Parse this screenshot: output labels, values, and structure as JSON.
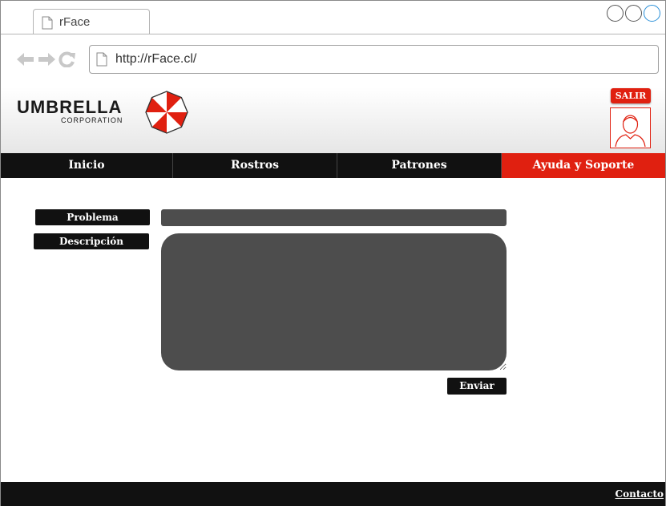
{
  "browser": {
    "tab_title": "rFace",
    "url": "http://rFace.cl/"
  },
  "header": {
    "logo_main": "UMBRELLA",
    "logo_sub": "CORPORATION",
    "logout_label": "SALIR"
  },
  "nav": {
    "items": [
      {
        "label": "Inicio"
      },
      {
        "label": "Rostros"
      },
      {
        "label": "Patrones"
      },
      {
        "label": "Ayuda y Soporte"
      }
    ]
  },
  "form": {
    "problem_label": "Problema",
    "description_label": "Descripción",
    "problem_value": "",
    "description_value": "",
    "send_label": "Enviar"
  },
  "footer": {
    "contact_label": "Contacto"
  },
  "colors": {
    "accent": "#e02010",
    "dark": "#111111",
    "field": "#4d4d4d"
  }
}
